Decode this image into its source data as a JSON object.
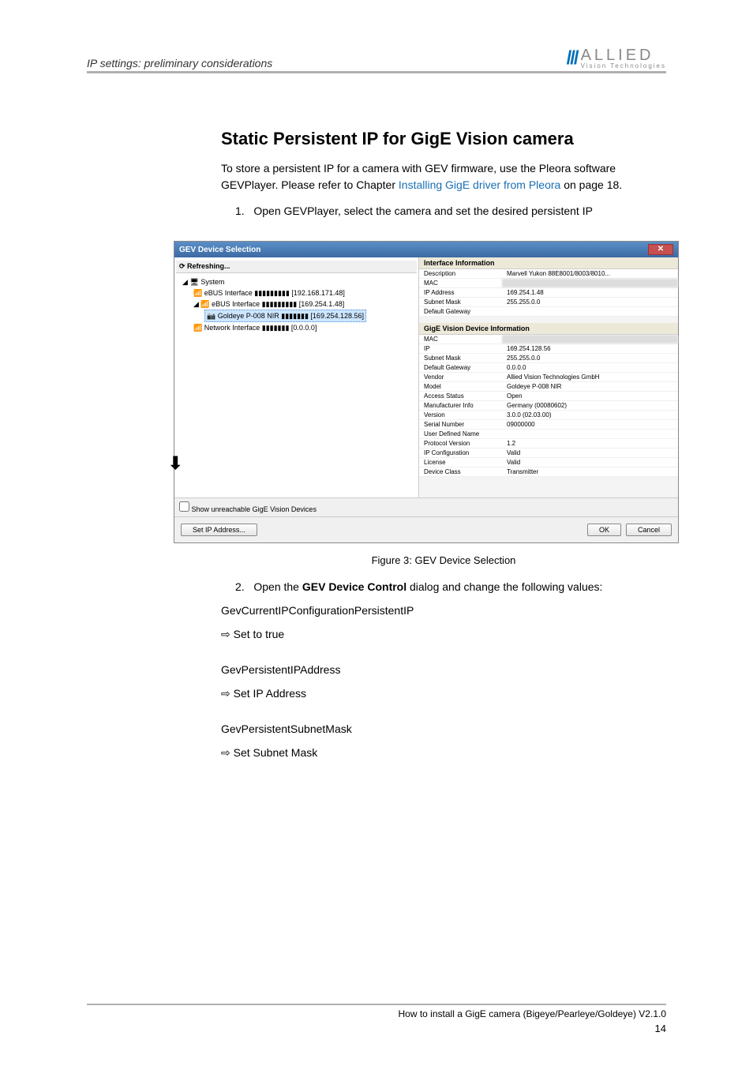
{
  "header": {
    "breadcrumb": "IP settings: preliminary considerations",
    "logo_main": "ALLIED",
    "logo_sub": "Vision Technologies"
  },
  "section": {
    "title": "Static Persistent IP for GigE Vision camera",
    "intro_1": "To store a persistent IP for a camera with GEV firmware, use the Pleora software GEVPlayer. Please refer to Chapter ",
    "intro_link": "Installing GigE driver from Pleora",
    "intro_2": " on page 18.",
    "step1_num": "1.",
    "step1": "Open GEVPlayer, select the camera and set the desired persistent IP"
  },
  "dialog": {
    "title": "GEV Device Selection",
    "refreshing": "Refreshing...",
    "tree": {
      "root": "System",
      "if1": "eBUS Interface ▮▮▮▮▮▮▮▮▮ [192.168.171.48]",
      "if2": "eBUS Interface ▮▮▮▮▮▮▮▮▮ [169.254.1.48]",
      "cam": "Goldeye P-008 NIR ▮▮▮▮▮▮▮ [169.254.128.56]",
      "net": "Network Interface ▮▮▮▮▮▮▮ [0.0.0.0]"
    },
    "interface_hd": "Interface Information",
    "interface": [
      [
        "Description",
        "Marvell Yukon 88E8001/8003/8010..."
      ],
      [
        "MAC",
        "▮▮▮▮▮▮▮▮▮"
      ],
      [
        "IP Address",
        "169.254.1.48"
      ],
      [
        "Subnet Mask",
        "255.255.0.0"
      ],
      [
        "Default Gateway",
        ""
      ]
    ],
    "device_hd": "GigE Vision Device Information",
    "device": [
      [
        "MAC",
        "▮▮▮▮▮▮▮▮▮"
      ],
      [
        "IP",
        "169.254.128.56"
      ],
      [
        "Subnet Mask",
        "255.255.0.0"
      ],
      [
        "Default Gateway",
        "0.0.0.0"
      ],
      [
        "Vendor",
        "Allied Vision Technologies GmbH"
      ],
      [
        "Model",
        "Goldeye P-008 NIR"
      ],
      [
        "Access Status",
        "Open"
      ],
      [
        "Manufacturer Info",
        "Germany (00080602)"
      ],
      [
        "Version",
        "3.0.0 (02.03.00)"
      ],
      [
        "Serial Number",
        "09000000"
      ],
      [
        "User Defined Name",
        ""
      ],
      [
        "Protocol Version",
        "1.2"
      ],
      [
        "IP Configuration",
        "Valid"
      ],
      [
        "License",
        "Valid"
      ],
      [
        "Device Class",
        "Transmitter"
      ]
    ],
    "checkbox": "Show unreachable GigE Vision Devices",
    "btn_setip": "Set IP Address...",
    "btn_ok": "OK",
    "btn_cancel": "Cancel"
  },
  "figure_caption": "Figure 3: GEV Device Selection",
  "steps2": {
    "num": "2.",
    "text": "Open the GEV Device Control dialog and change the following values:",
    "i1": "GevCurrentIPConfigurationPersistentIP",
    "i1a": "Set to true",
    "i2": "GevPersistentIPAddress",
    "i2a": "Set IP Address",
    "i3": "GevPersistentSubnetMask",
    "i3a": "Set Subnet Mask"
  },
  "footer": {
    "text": "How to install a GigE camera (Bigeye/Pearleye/Goldeye) V2.1.0",
    "page": "14"
  }
}
